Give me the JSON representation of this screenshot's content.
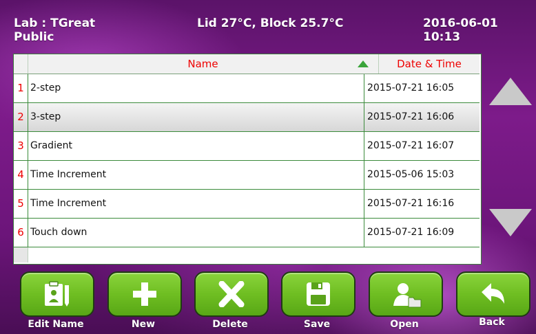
{
  "status": {
    "lab": "Lab : TGreat",
    "folder": "Public",
    "temperature": "Lid 27°C, Block 25.7°C",
    "datetime": "2016-06-01 10:13"
  },
  "table": {
    "columns": {
      "name": "Name",
      "datetime": "Date & Time"
    },
    "sort": {
      "column": "Name",
      "direction": "ascending"
    },
    "selected_row": 2,
    "rows": [
      {
        "index": "1",
        "name": "2-step",
        "datetime": "2015-07-21 16:05"
      },
      {
        "index": "2",
        "name": "3-step",
        "datetime": "2015-07-21 16:06"
      },
      {
        "index": "3",
        "name": "Gradient",
        "datetime": "2015-07-21 16:07"
      },
      {
        "index": "4",
        "name": "Time Increment",
        "datetime": "2015-05-06 15:03"
      },
      {
        "index": "5",
        "name": "Time Increment",
        "datetime": "2015-07-21 16:16"
      },
      {
        "index": "6",
        "name": "Touch down",
        "datetime": "2015-07-21 16:09"
      }
    ]
  },
  "scroll": {
    "up_icon": "triangle-up-icon",
    "down_icon": "triangle-down-icon"
  },
  "buttons": {
    "edit_name": {
      "label": "Edit Name",
      "icon": "edit-name-icon"
    },
    "new": {
      "label": "New",
      "icon": "plus-icon"
    },
    "delete": {
      "label": "Delete",
      "icon": "x-icon"
    },
    "save": {
      "label": "Save",
      "icon": "floppy-disk-icon"
    },
    "open": {
      "label": "Open",
      "icon": "user-folder-icon"
    },
    "back": {
      "label": "Back",
      "icon": "back-arrow-icon"
    }
  },
  "colors": {
    "button_green": "#6fbe22",
    "header_text_red": "#e00000",
    "row_border_green": "#3a8a3a"
  }
}
